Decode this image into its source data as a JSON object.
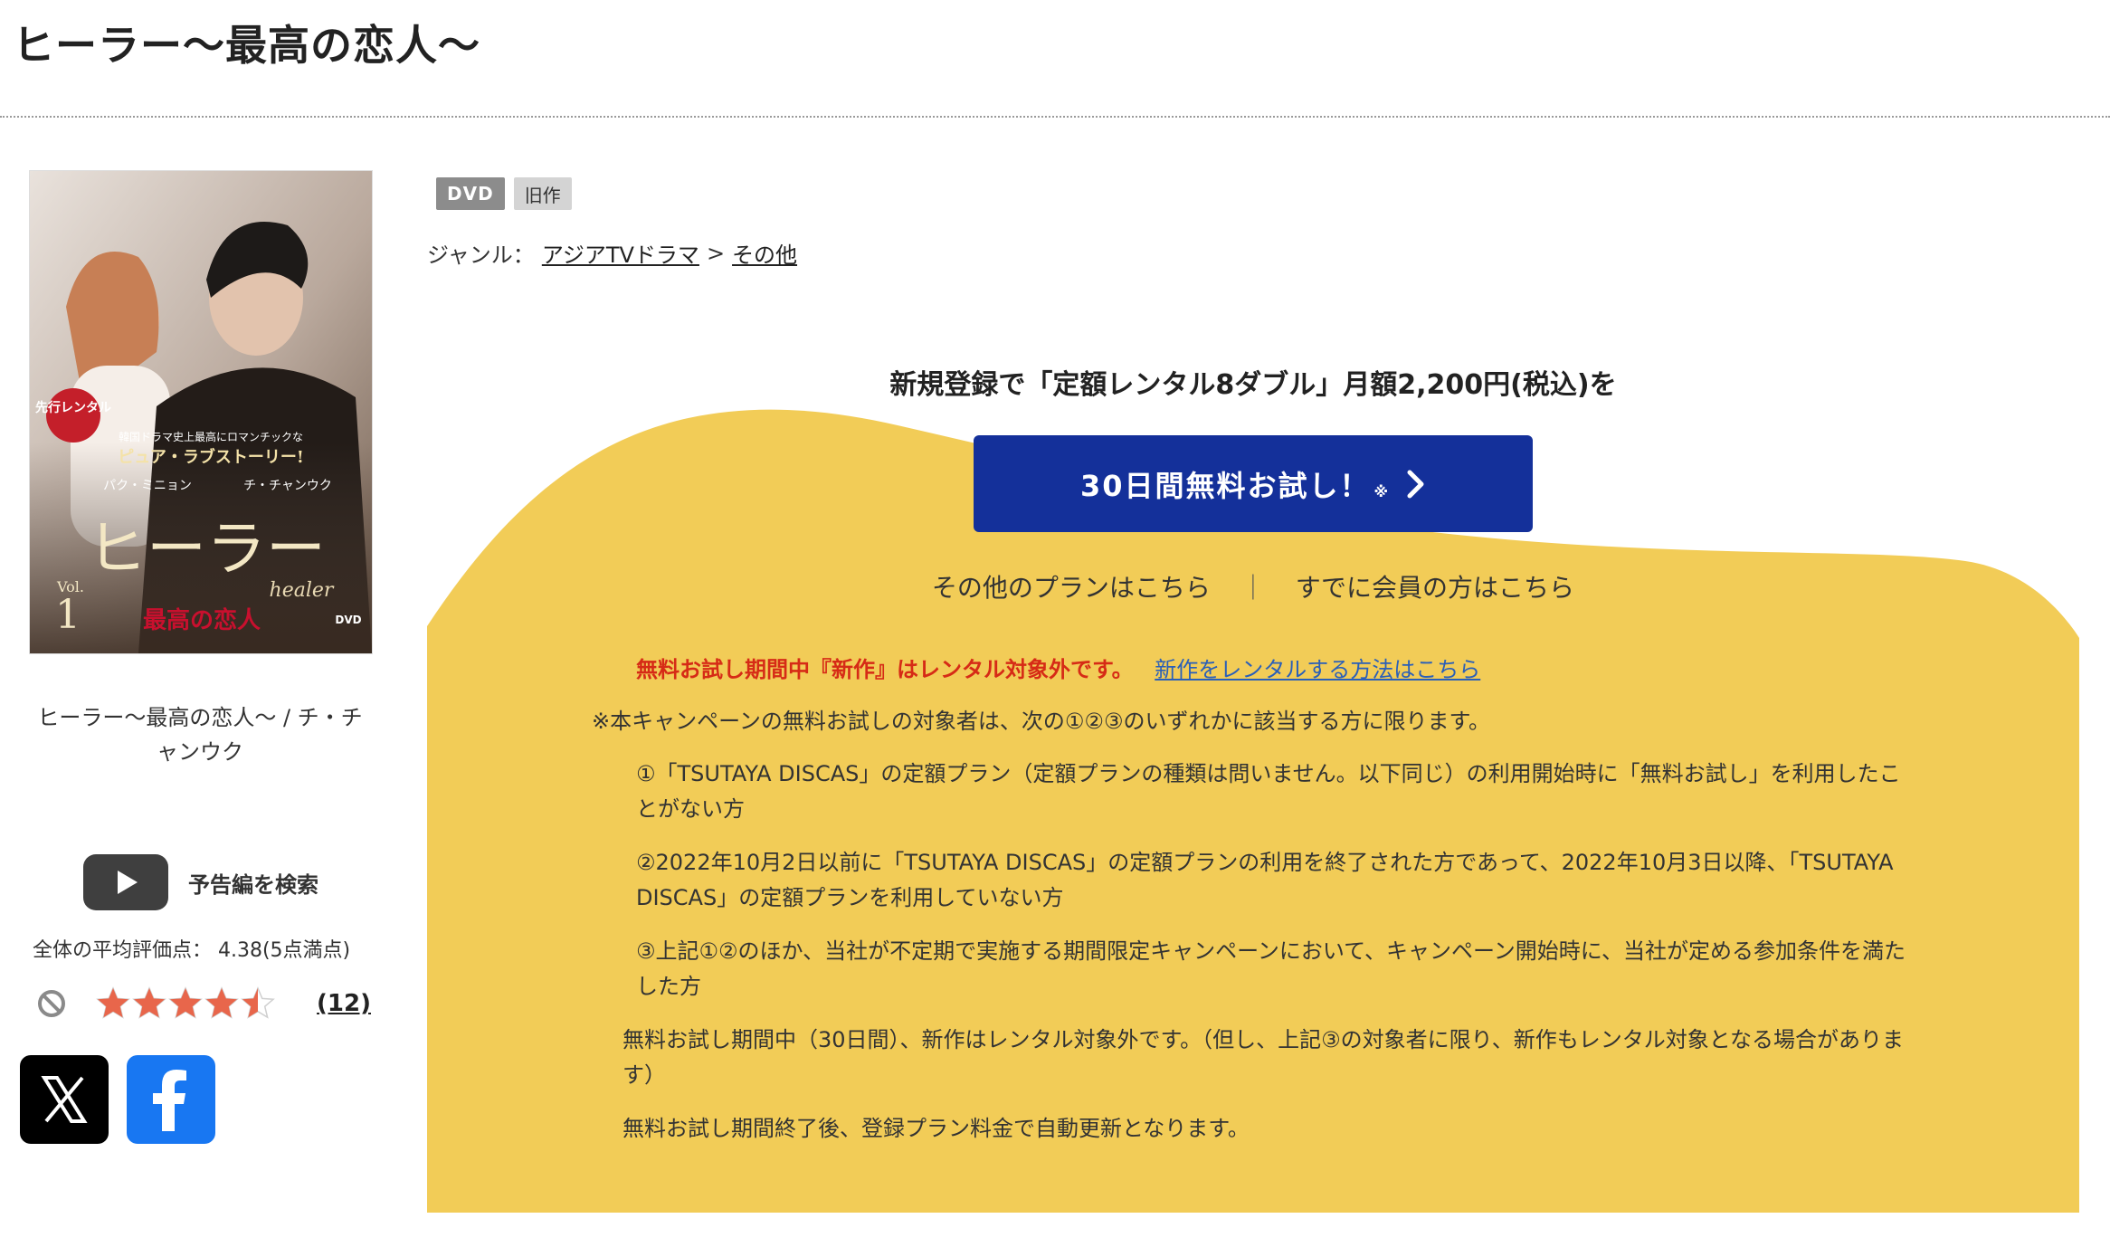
{
  "title": "ヒーラー〜最高の恋人〜",
  "left": {
    "item_name": "ヒーラー〜最高の恋人〜 / チ・チャンウク",
    "trailer_label": "予告編を検索",
    "rating_summary": "全体の平均評価点： 4.38(5点満点)",
    "rating_value": 4.38,
    "rating_max": 5,
    "review_count": "(12)",
    "share_icons": [
      "x-icon",
      "facebook-icon"
    ],
    "cover": {
      "line1": "ヒーラー",
      "line2": "healer",
      "line3": "最高の恋人",
      "vol_label": "Vol.",
      "vol_number": "1",
      "dvd": "DVD",
      "badge": "先行レンタル",
      "tagline": "韓国ドラマ史上最高にロマンチックな",
      "tagline2": "ピュア・ラブストーリー!",
      "cast1": "パク・ミニョン",
      "cast2": "チ・チャンウク"
    }
  },
  "badges": {
    "dvd": "DVD",
    "old": "旧作"
  },
  "genre": {
    "label": "ジャンル：",
    "link1": "アジアTVドラマ",
    "sep": ">",
    "link2": "その他"
  },
  "promo": {
    "headline": "新規登録で「定額レンタル8ダブル」月額2,200円(税込)を",
    "cta": "30日間無料お試し！",
    "cta_mark": "※",
    "other_plans": "その他のプランはこちら",
    "separator": "｜",
    "member_link": "すでに会員の方はこちら",
    "warning": "無料お試し期間中『新作』はレンタル対象外です。",
    "warning_link": "新作をレンタルする方法はこちら",
    "note_intro": "※本キャンペーンの無料お試しの対象者は、次の①②③のいずれかに該当する方に限ります。",
    "note1": "①「TSUTAYA DISCAS」の定額プラン（定額プランの種類は問いません。以下同じ）の利用開始時に「無料お試し」を利用したことがない方",
    "note2": "②2022年10月2日以前に「TSUTAYA DISCAS」の定額プランの利用を終了された方であって、2022年10月3日以降、「TSUTAYA DISCAS」の定額プランを利用していない方",
    "note3": "③上記①②のほか、当社が不定期で実施する期間限定キャンペーンにおいて、キャンペーン開始時に、当社が定める参加条件を満たした方",
    "note4": "無料お試し期間中（30日間）、新作はレンタル対象外です。（但し、上記③の対象者に限り、新作もレンタル対象となる場合があります）",
    "note5": "無料お試し期間終了後、登録プラン料金で自動更新となります。"
  },
  "colors": {
    "promo_yellow": "#f2cc57",
    "cta_blue": "#14309a",
    "warning_red": "#d62b16",
    "link_blue": "#2a5fb8",
    "star": "#e8664b"
  }
}
